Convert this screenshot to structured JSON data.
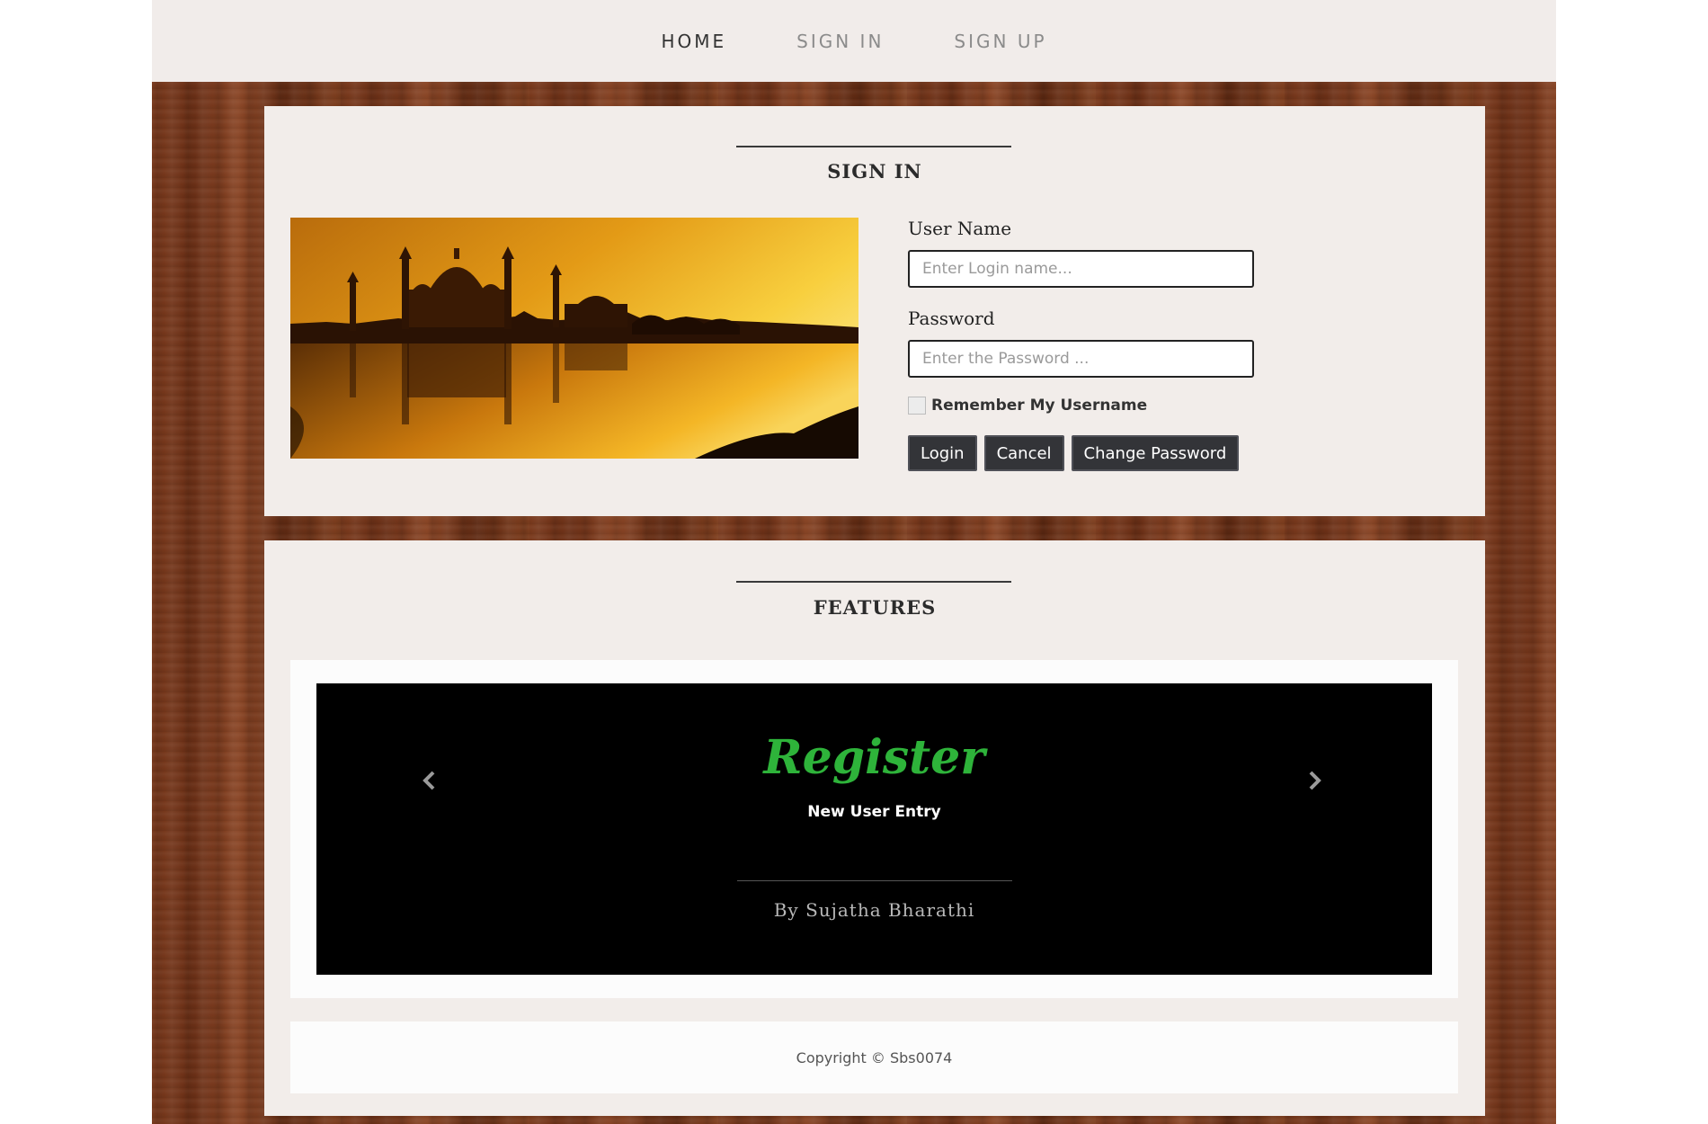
{
  "nav": {
    "items": [
      {
        "label": "HOME"
      },
      {
        "label": "SIGN IN"
      },
      {
        "label": "SIGN UP"
      }
    ]
  },
  "signin": {
    "title": "SIGN IN",
    "username_label": "User Name",
    "username_placeholder": "Enter Login name...",
    "username_value": "",
    "password_label": "Password",
    "password_placeholder": "Enter the Password ...",
    "password_value": "",
    "remember_label": "Remember My Username",
    "remember_checked": false,
    "login_label": "Login",
    "cancel_label": "Cancel",
    "change_password_label": "Change Password"
  },
  "features": {
    "title": "FEATURES",
    "slide": {
      "title": "Register",
      "caption": "New User Entry",
      "author": "By Sujatha Bharathi"
    },
    "icons": {
      "prev": "chevron-left-icon",
      "next": "chevron-right-icon"
    }
  },
  "footer": {
    "copyright": "Copyright © Sbs0074"
  },
  "colors": {
    "slide_title": "#2eb33a",
    "button_bg": "#333438",
    "panel_bg": "#f2edea"
  }
}
